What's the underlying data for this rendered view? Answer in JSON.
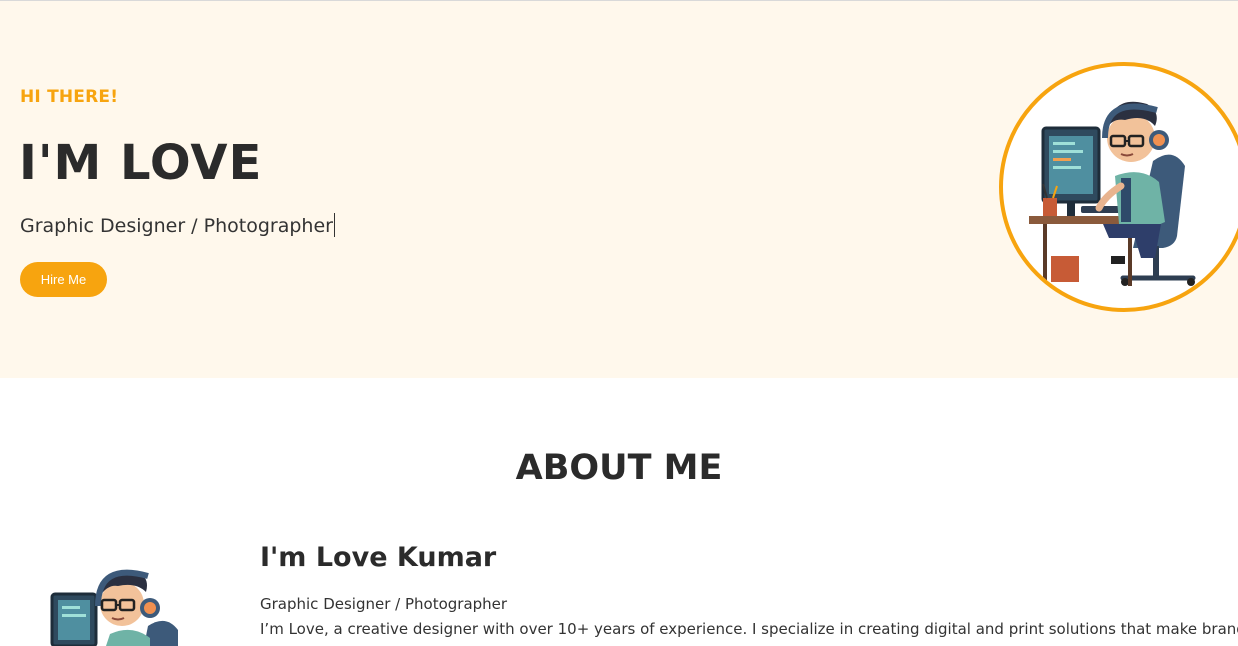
{
  "hero": {
    "greeting": "HI THERE!",
    "name": "I'M LOVE",
    "role": "Graphic Designer / Photographer",
    "cta_label": "Hire Me",
    "avatar_icon": "developer-illustration-icon"
  },
  "about": {
    "title": "ABOUT ME",
    "name": "I'm Love Kumar",
    "role": "Graphic Designer / Photographer",
    "text": "I’m Love, a creative designer with over 10+ years of experience. I specialize in creating digital and print solutions that make brands stand"
  },
  "colors": {
    "accent": "#f7a40f",
    "hero_bg": "#fff8ec",
    "text": "#2b2b2b"
  }
}
